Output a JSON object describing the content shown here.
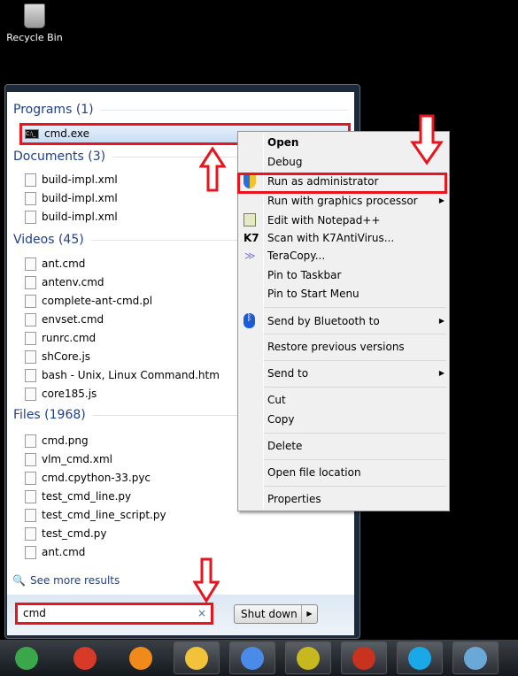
{
  "desktop": {
    "recycle_bin": "Recycle Bin"
  },
  "start_menu": {
    "programs_header": "Programs (1)",
    "programs": [
      {
        "label": "cmd.exe",
        "icon": "cmd-icon"
      }
    ],
    "documents_header": "Documents (3)",
    "documents": [
      {
        "label": "build-impl.xml"
      },
      {
        "label": "build-impl.xml"
      },
      {
        "label": "build-impl.xml"
      }
    ],
    "videos_header": "Videos (45)",
    "videos": [
      {
        "label": "ant.cmd"
      },
      {
        "label": "antenv.cmd"
      },
      {
        "label": "complete-ant-cmd.pl"
      },
      {
        "label": "envset.cmd"
      },
      {
        "label": "runrc.cmd"
      },
      {
        "label": "shCore.js"
      },
      {
        "label": "bash - Unix, Linux Command.htm"
      },
      {
        "label": "core185.js"
      }
    ],
    "files_header": "Files (1968)",
    "files": [
      {
        "label": "cmd.png"
      },
      {
        "label": "vlm_cmd.xml"
      },
      {
        "label": "cmd.cpython-33.pyc"
      },
      {
        "label": "test_cmd_line.py"
      },
      {
        "label": "test_cmd_line_script.py"
      },
      {
        "label": "test_cmd.py"
      },
      {
        "label": "ant.cmd"
      }
    ],
    "see_more": "See more results",
    "search_value": "cmd",
    "clear_glyph": "×",
    "shutdown": "Shut down",
    "shutdown_arrow": "▶"
  },
  "context_menu": {
    "items": [
      {
        "label": "Open"
      },
      {
        "label": "Debug"
      },
      {
        "label": "Run as administrator"
      },
      {
        "label": "Run with graphics processor"
      },
      {
        "label": "Edit with Notepad++"
      },
      {
        "label": "Scan with K7AntiVirus..."
      },
      {
        "label": "TeraCopy..."
      },
      {
        "label": "Pin to Taskbar"
      },
      {
        "label": "Pin to Start Menu"
      },
      {
        "label": "Send by Bluetooth to"
      },
      {
        "label": "Restore previous versions"
      },
      {
        "label": "Send to"
      },
      {
        "label": "Cut"
      },
      {
        "label": "Copy"
      },
      {
        "label": "Delete"
      },
      {
        "label": "Open file location"
      },
      {
        "label": "Properties"
      }
    ],
    "submenu_arrow": "▶"
  },
  "colors": {
    "highlight": "#e8141e",
    "header": "#1e3f8e"
  },
  "taskbar": {
    "apps": [
      "start-orb",
      "foxit-reader",
      "media-player",
      "explorer",
      "chrome",
      "app-yellow",
      "psiphon",
      "skype",
      "photo-viewer"
    ]
  }
}
